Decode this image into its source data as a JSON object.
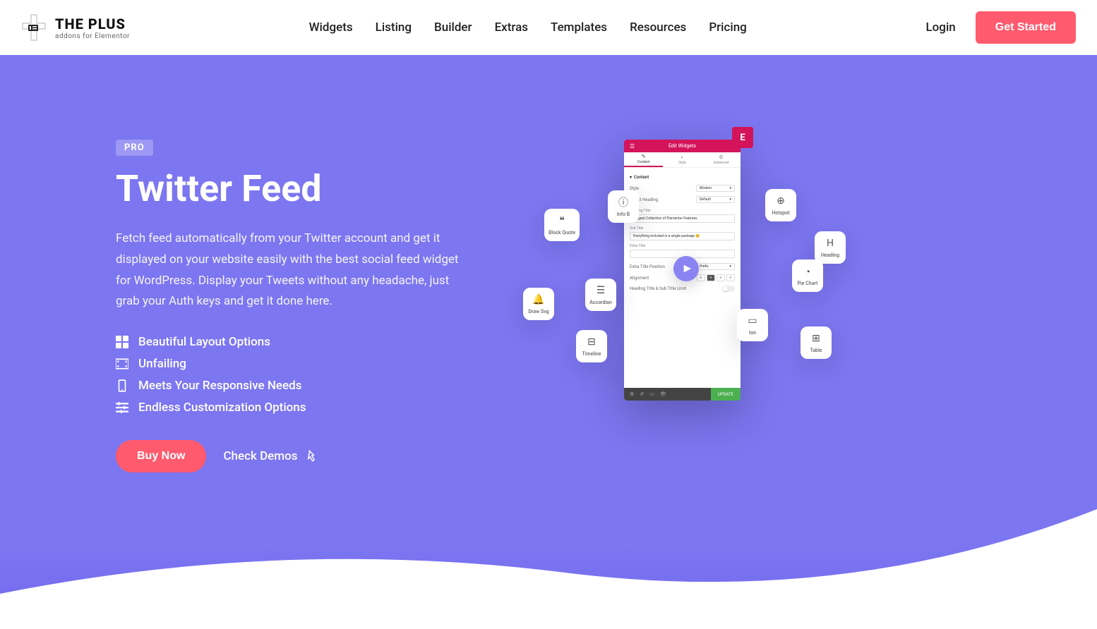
{
  "header": {
    "logo_title": "THE PLUS",
    "logo_sub": "addons for Elementor",
    "nav": [
      "Widgets",
      "Listing",
      "Builder",
      "Extras",
      "Templates",
      "Resources",
      "Pricing"
    ],
    "login": "Login",
    "cta": "Get Started"
  },
  "hero": {
    "badge": "PRO",
    "title": "Twitter Feed",
    "description": "Fetch feed automatically from your Twitter account and get it displayed on your website easily with the best social feed widget for WordPress. Display your Tweets without any headache, just grab your Auth keys and get it done here.",
    "features": [
      "Beautiful Layout Options",
      "Unfailing",
      "Meets Your Responsive Needs",
      "Endless Customization Options"
    ],
    "buy": "Buy Now",
    "demos": "Check Demos"
  },
  "panel": {
    "title": "Edit Widgets",
    "elem": "E",
    "tabs": [
      "Content",
      "Style",
      "Advanced"
    ],
    "section": "Content",
    "style_label": "Style",
    "style_val": "Modern",
    "heading_select_label": "Select Heading",
    "heading_select_val": "Default",
    "heading_title_label": "Heading Title",
    "heading_title_val": "Biggest Collection of Elementor Features",
    "sub_title_label": "Sub Title",
    "sub_title_val": "Everything included in a single package 😊",
    "extra_title_label": "Extra Title",
    "extra_pos_label": "Extra Title Position",
    "extra_pos_val": "Prefix",
    "align_label": "Alignment",
    "limit_label": "Heading Title & Sub Title Limit",
    "update": "UPDATE"
  },
  "floats": {
    "info": "Info B",
    "quote": "Block Quote",
    "accordion": "Accordian",
    "svg": "Draw Svg",
    "timeline": "Timeline",
    "hotspot": "Hotspot",
    "heading": "Heading",
    "pie": "Pie Chart",
    "button": "ton",
    "table": "Table"
  }
}
